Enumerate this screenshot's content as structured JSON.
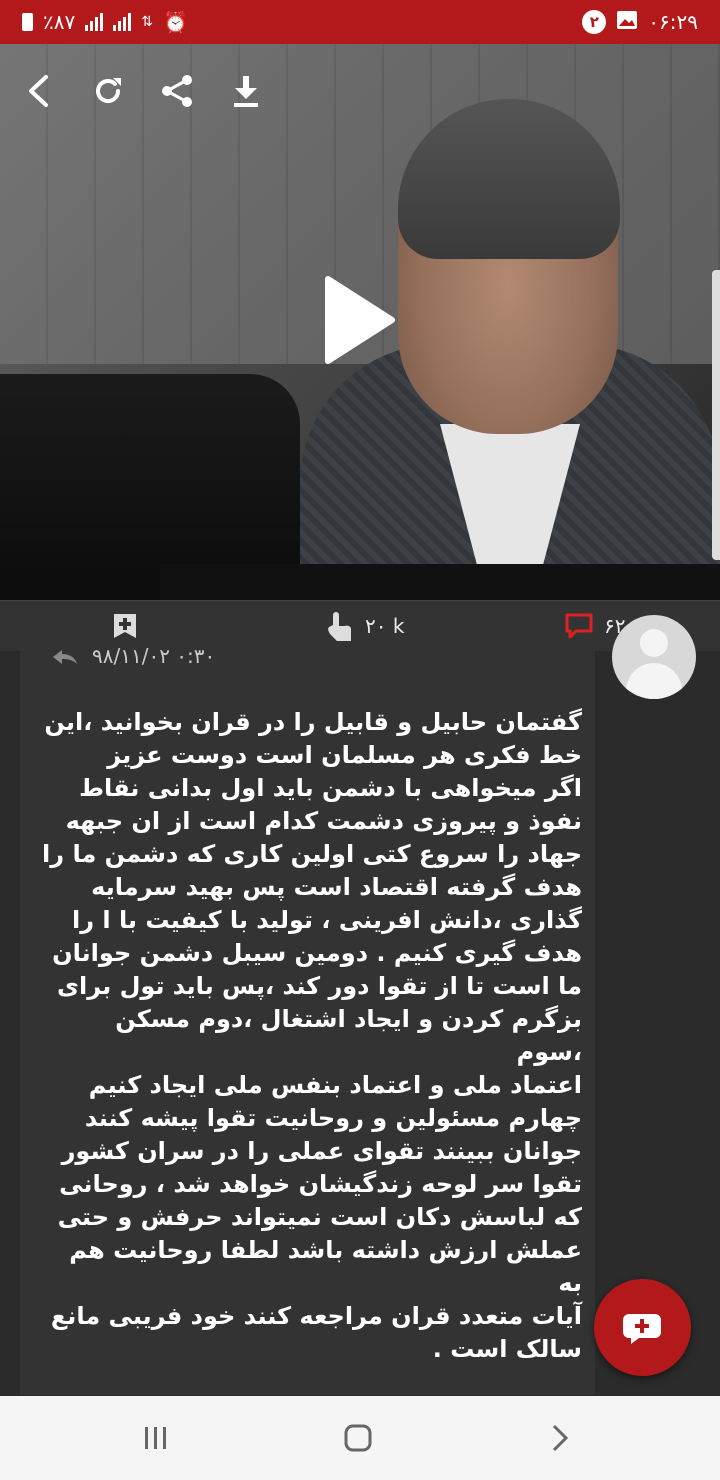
{
  "status_bar": {
    "time": "۰۶:۲۹",
    "notification_count": "۲",
    "battery": "٪۸۷"
  },
  "video": {
    "play_icon": "play-icon"
  },
  "toolbar": {
    "icons": [
      "back-icon",
      "refresh-icon",
      "share-icon",
      "download-icon"
    ]
  },
  "actions": {
    "comments_count": "۶۲",
    "likes_count": "۲۰ k",
    "bookmark_icon": "bookmark-add-icon",
    "like_icon": "hand-tap-icon",
    "comment_icon": "comment-icon"
  },
  "comment": {
    "date": "۹۸/۱۱/۰۲ ۰:۳۰",
    "text": "گفتمان حابیل و قابیل را در قران بخوانید ،این\nخط فکری هر مسلمان است  دوست عزیز\nاگر میخواهی با دشمن باید اول بدانی نقاط\nنفوذ و پیروزی دشمت کدام است از ان جبهه\nجهاد را سروع کتی اولین کاری که دشمن ما را\nهدف گرفته اقتصاد است پس بهید سرمایه\nگذاری ،دانش افرینی ، تولید با کیفیت با ا را\nهدف گیری کنیم . دومین سیبل دشمن جوانان\nما است تا از تقوا دور کند ،پس باید تول برای\nبزگرم کردن و ایجاد اشتغال ،دوم مسکن ،سوم\nاعتماد ملی و اعتماد بنفس ملی ایجاد کنیم\nچهارم مسئولین و روحانیت تقوا پیشه کنند\nجوانان ببینند تقوای عملی را در سران کشور\nتقوا سر لوحه زندگیشان خواهد شد ، روحانی\nکه لباسش دکان است نمیتواند حرفش و حتی\nعملش ارزش داشته باشد لطفا روحانیت هم به\nآیات متعدد قران مراجعه کنند خود فریبی مانع\nسالک است ."
  },
  "colors": {
    "accent": "#b3191a",
    "background": "#2b2b2b",
    "card": "#333333"
  }
}
